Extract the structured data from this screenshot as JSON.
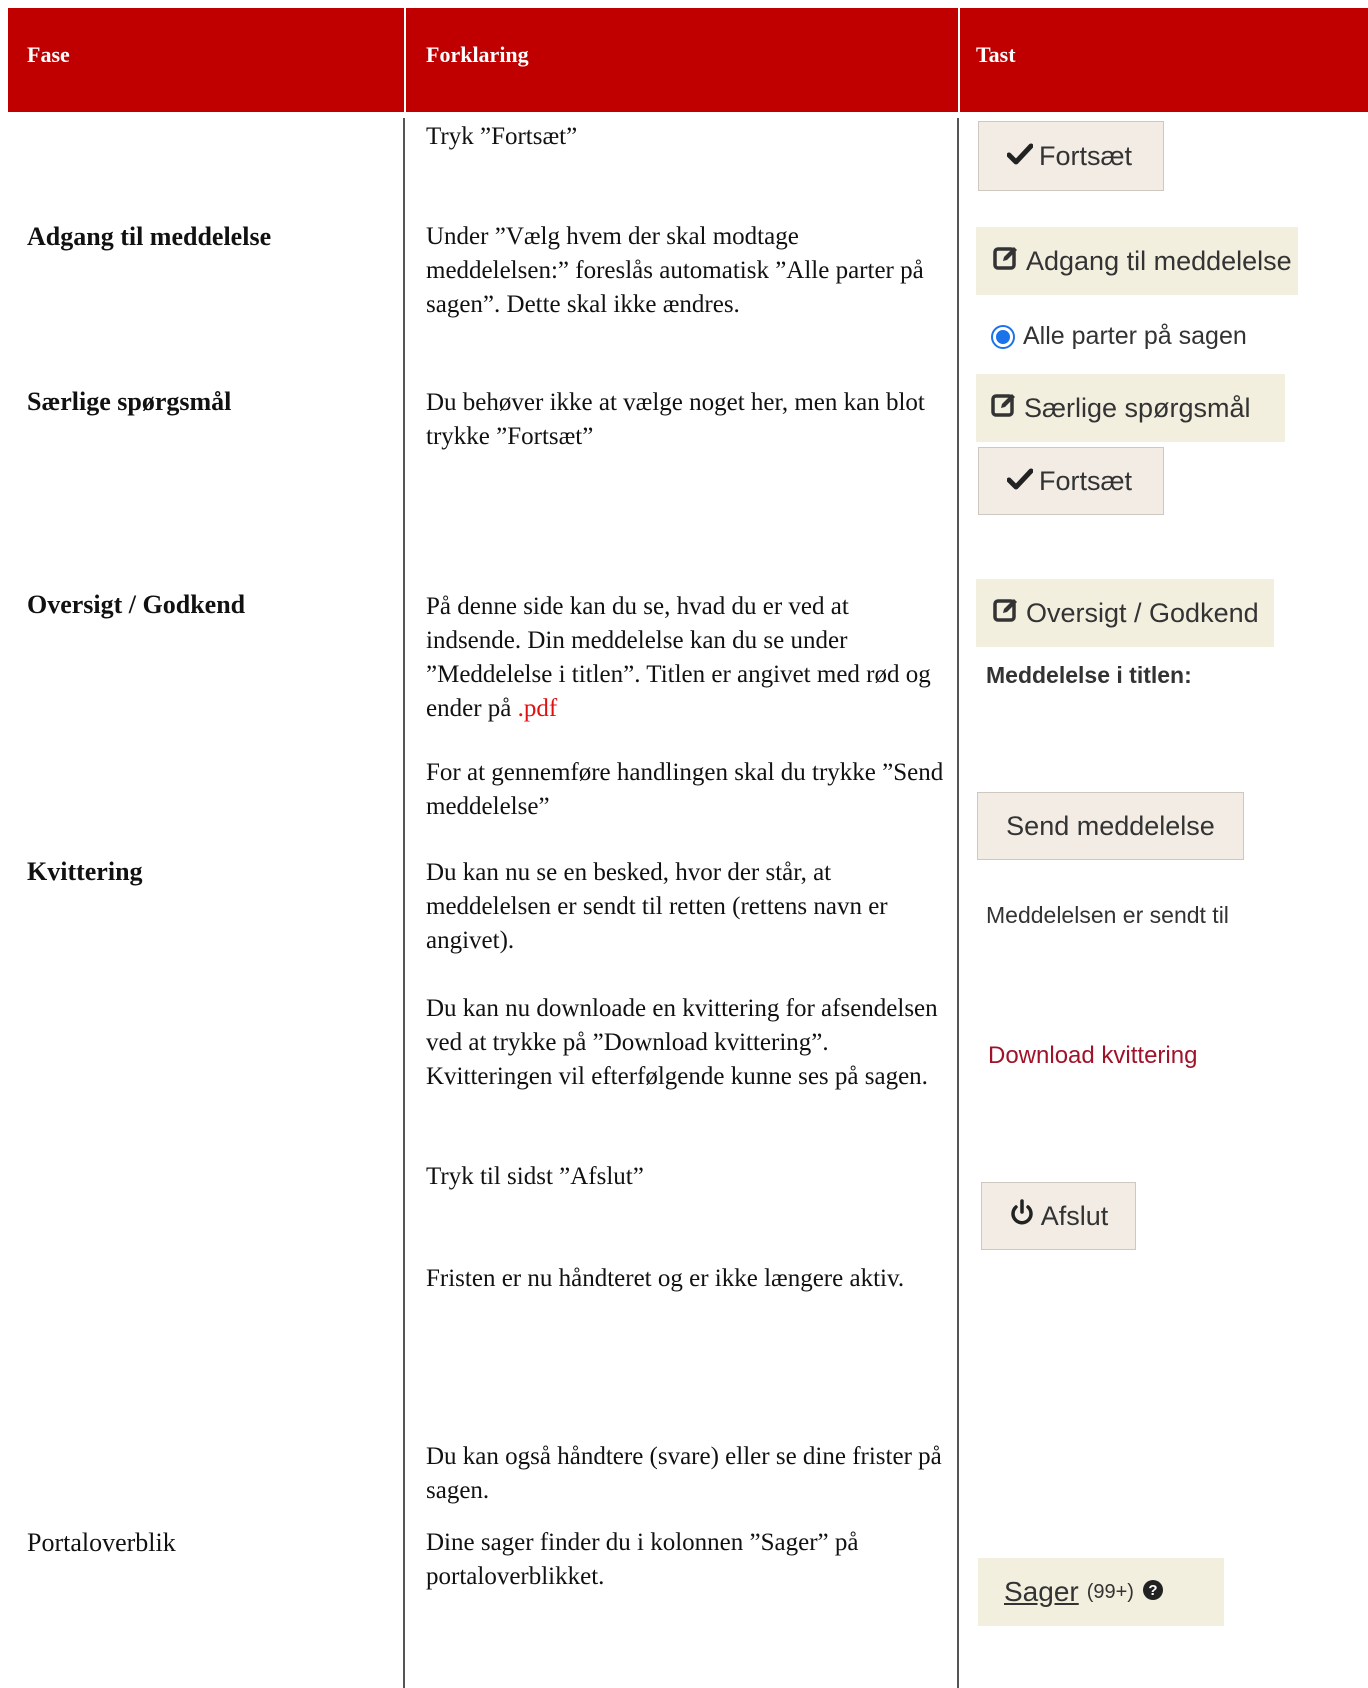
{
  "header": {
    "col1": "Fase",
    "col2": "Forklaring",
    "col3": "Tast"
  },
  "rows": {
    "fortsaet1": {
      "explanation": "Tryk ”Fortsæt”",
      "button": "Fortsæt",
      "icon": "check-icon"
    },
    "adgang": {
      "phase": "Adgang til meddelelse",
      "explanation": "Under ”Vælg hvem der skal modtage meddelelsen:” foreslås automatisk ”Alle parter på sagen”. Dette skal ikke ændres.",
      "tab": "Adgang til meddelelse",
      "icon": "edit-icon",
      "radio_label": "Alle parter på sagen"
    },
    "saerlige": {
      "phase": "Særlige spørgsmål",
      "explanation": "Du behøver ikke at vælge noget her, men kan blot trykke  ”Fortsæt”",
      "tab": "Særlige spørgsmål",
      "icon": "edit-icon",
      "button": "Fortsæt"
    },
    "oversigt": {
      "phase": "Oversigt / Godkend",
      "explanation": "På denne side kan du se, hvad du er ved at indsende. Din meddelelse kan du se under ”Meddelelse i titlen”. Titlen er angivet med rød og ender på",
      "explanation_red": ".pdf",
      "explanation2": "For at gennemføre handlingen skal du trykke ”Send meddelelse”",
      "tab": "Oversigt / Godkend",
      "icon": "edit-icon",
      "label": "Meddelelse i titlen:",
      "button": "Send meddelelse"
    },
    "kvittering": {
      "phase": "Kvittering",
      "explanation": "Du kan nu se en besked, hvor der står, at meddelelsen er sendt til retten (rettens navn er angivet).",
      "status": "Meddelelsen er sendt til",
      "explanation2": "Du kan nu downloade en kvittering for afsendelsen ved at trykke på ”Download kvittering”. Kvitteringen vil efterfølgende kunne ses på sagen.",
      "link": "Download kvittering",
      "explanation3": "Tryk til sidst ”Afslut”",
      "button": "Afslut",
      "icon": "power-icon",
      "explanation4": "Fristen er nu håndteret og er ikke længere aktiv.",
      "explanation5": "Du kan også håndtere (svare) eller se dine frister på sagen."
    },
    "portal": {
      "phase": "Portaloverblik",
      "explanation": "Dine sager finder du i kolonnen ”Sager” på portaloverblikket.",
      "tab": "Sager",
      "count": "(99+)",
      "icon": "question-circle-icon"
    }
  },
  "colors": {
    "header_bg": "#c00000",
    "red_text": "#e01010",
    "link": "#a0122a"
  }
}
